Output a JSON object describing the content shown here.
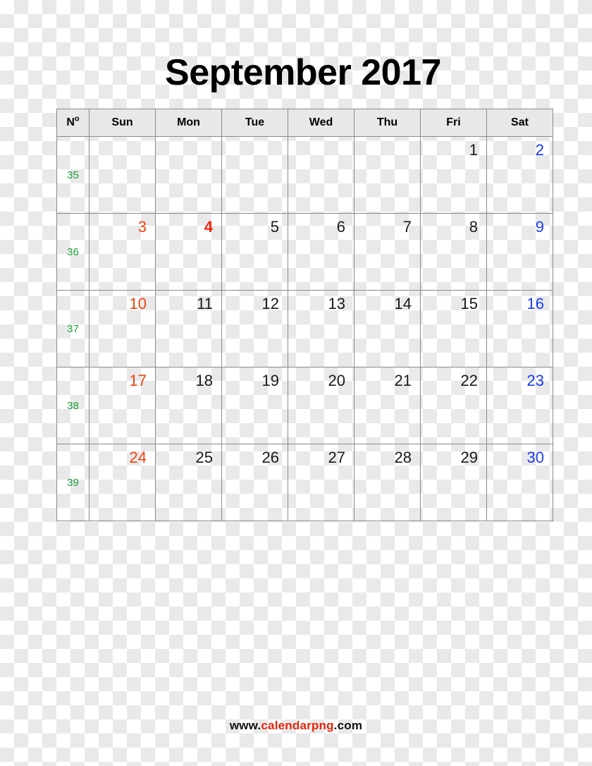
{
  "title": "September 2017",
  "footer": {
    "prefix": "www.",
    "brand": "calendarpng",
    "suffix": ".com"
  },
  "colors": {
    "sunday": "#f0420a",
    "saturday": "#1a3cf0",
    "weekday": "#1a1a1a",
    "week_number": "#1aa03c",
    "holiday": "#f0260a",
    "brand": "#e8230b",
    "header_bg": "#e8e8e8",
    "grid_line": "#8a8a8a"
  },
  "header": {
    "week_label": "N",
    "week_label_sup": "o",
    "days": [
      "Sun",
      "Mon",
      "Tue",
      "Wed",
      "Thu",
      "Fri",
      "Sat"
    ]
  },
  "weeks": [
    {
      "number": "35",
      "days": [
        {
          "label": "",
          "kind": "empty"
        },
        {
          "label": "",
          "kind": "empty"
        },
        {
          "label": "",
          "kind": "empty"
        },
        {
          "label": "",
          "kind": "empty"
        },
        {
          "label": "",
          "kind": "empty"
        },
        {
          "label": "1",
          "kind": "weekday"
        },
        {
          "label": "2",
          "kind": "sat"
        }
      ]
    },
    {
      "number": "36",
      "days": [
        {
          "label": "3",
          "kind": "sun"
        },
        {
          "label": "4",
          "kind": "holiday"
        },
        {
          "label": "5",
          "kind": "weekday"
        },
        {
          "label": "6",
          "kind": "weekday"
        },
        {
          "label": "7",
          "kind": "weekday"
        },
        {
          "label": "8",
          "kind": "weekday"
        },
        {
          "label": "9",
          "kind": "sat"
        }
      ]
    },
    {
      "number": "37",
      "days": [
        {
          "label": "10",
          "kind": "sun"
        },
        {
          "label": "11",
          "kind": "weekday"
        },
        {
          "label": "12",
          "kind": "weekday"
        },
        {
          "label": "13",
          "kind": "weekday"
        },
        {
          "label": "14",
          "kind": "weekday"
        },
        {
          "label": "15",
          "kind": "weekday"
        },
        {
          "label": "16",
          "kind": "sat"
        }
      ]
    },
    {
      "number": "38",
      "days": [
        {
          "label": "17",
          "kind": "sun"
        },
        {
          "label": "18",
          "kind": "weekday"
        },
        {
          "label": "19",
          "kind": "weekday"
        },
        {
          "label": "20",
          "kind": "weekday"
        },
        {
          "label": "21",
          "kind": "weekday"
        },
        {
          "label": "22",
          "kind": "weekday"
        },
        {
          "label": "23",
          "kind": "sat"
        }
      ]
    },
    {
      "number": "39",
      "days": [
        {
          "label": "24",
          "kind": "sun"
        },
        {
          "label": "25",
          "kind": "weekday"
        },
        {
          "label": "26",
          "kind": "weekday"
        },
        {
          "label": "27",
          "kind": "weekday"
        },
        {
          "label": "28",
          "kind": "weekday"
        },
        {
          "label": "29",
          "kind": "weekday"
        },
        {
          "label": "30",
          "kind": "sat"
        }
      ]
    }
  ]
}
